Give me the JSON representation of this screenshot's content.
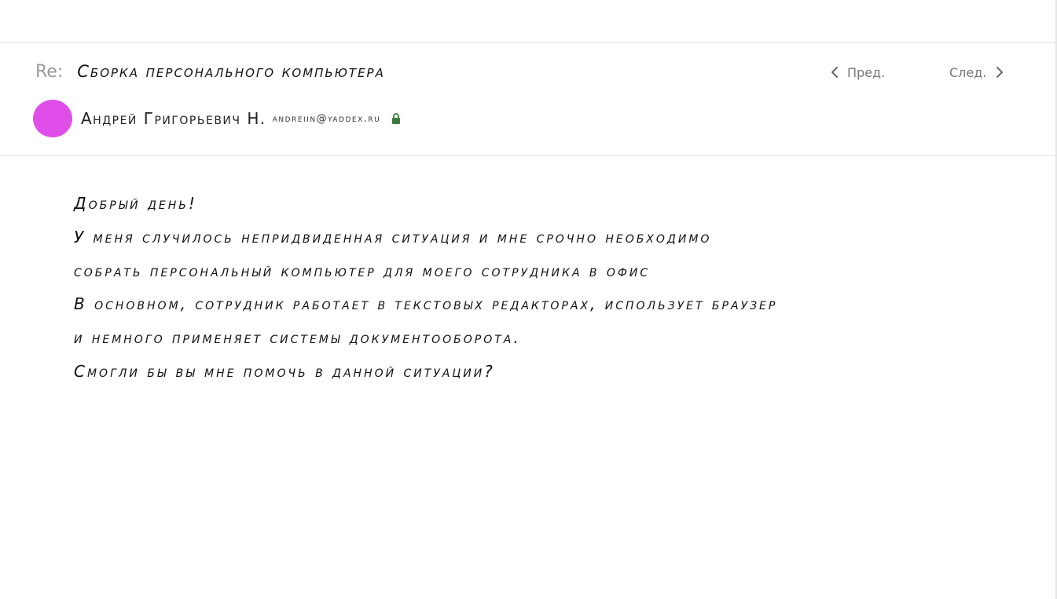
{
  "message": {
    "subject_prefix": "Re:",
    "subject": "Сборка персонального компьютера",
    "nav": {
      "prev_label": "Пред.",
      "next_label": "След."
    },
    "sender": {
      "name": "Андрей Григорьевич Н.",
      "email": "andreiin@yaddex.ru",
      "avatar_color": "#df4ee9",
      "lock_color": "#3d7a3d"
    },
    "body_lines": [
      "Добрый день!",
      "У меня случилось непридвиденная ситуация и мне срочно необходимо",
      "собрать персональный компьютер для моего сотрудника в офис",
      "В основном, сотрудник работает в текстовых редакторах, использует браузер",
      "и немного применяет системы документооборота.",
      "Смогли бы вы мне помочь в данной ситуации?"
    ]
  },
  "icons": {
    "prev": "chevron-left-icon",
    "next": "chevron-right-icon",
    "lock": "lock-icon"
  }
}
